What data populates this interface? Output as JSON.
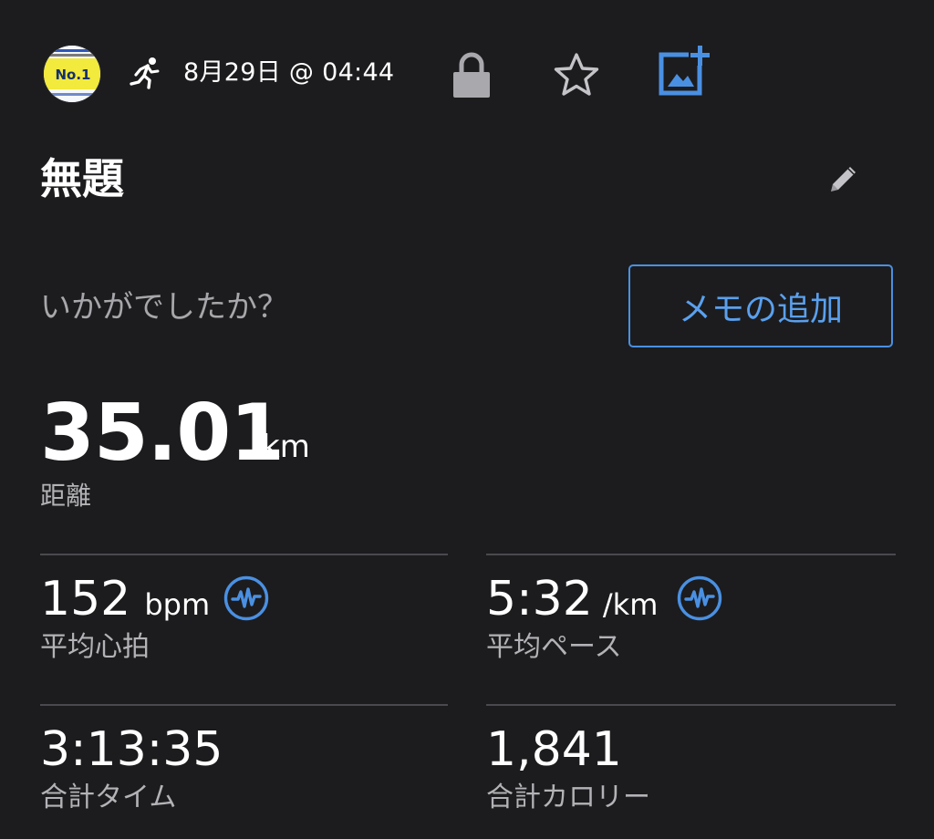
{
  "header": {
    "avatar": {
      "label": "No.1",
      "description_icon": "race-badge-avatar"
    },
    "activity_icon": "running-person-icon",
    "datetime": "8月29日 @ 04:44",
    "icons": [
      "lock-icon",
      "star-icon",
      "add-photo-icon"
    ],
    "accent_color": "#4a90e2"
  },
  "title": "無題",
  "prompt_question": "いかがでしたか？",
  "memo_button_label": "メモの追加",
  "distance": {
    "value": "35.01",
    "unit": "km",
    "label": "距離"
  },
  "stats": [
    {
      "value": "152",
      "unit": "bpm",
      "label": "平均心拍",
      "icon": "pulse-icon"
    },
    {
      "value": "5:32",
      "unit": "/km",
      "label": "平均ペース",
      "icon": "pulse-icon"
    },
    {
      "value": "3:13:35",
      "unit": "",
      "label": "合計タイム"
    },
    {
      "value": "1,841",
      "unit": "",
      "label": "合計カロリー"
    }
  ]
}
